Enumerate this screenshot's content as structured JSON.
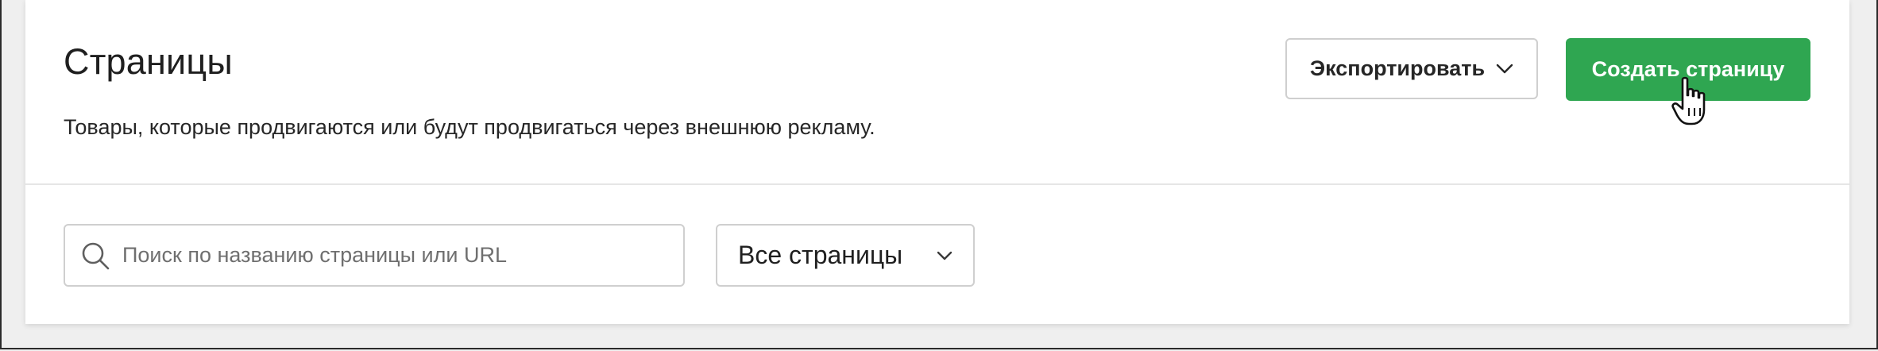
{
  "header": {
    "title": "Страницы",
    "subtitle": "Товары, которые продвигаются или будут продвигаться через внешнюю рекламу."
  },
  "actions": {
    "export_label": "Экспортировать",
    "create_label": "Создать страницу"
  },
  "filters": {
    "search_placeholder": "Поиск по названию страницы или URL",
    "search_value": "",
    "select_value": "Все страницы"
  },
  "icons": {
    "export_chevron": "chevron-down-icon",
    "search": "search-icon",
    "select_chevron": "chevron-down-icon",
    "cursor": "hand-pointer-icon"
  },
  "colors": {
    "primary": "#2fa651",
    "border": "#cfcfcf",
    "background": "#efefef"
  }
}
